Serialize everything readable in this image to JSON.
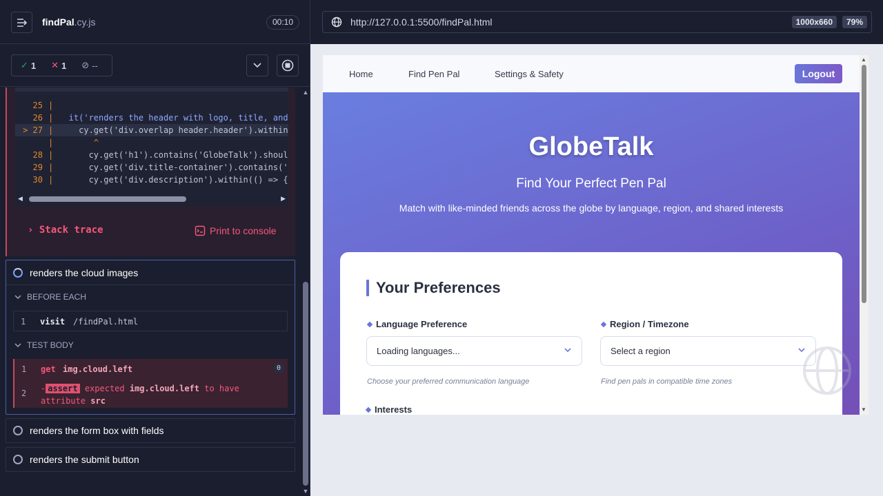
{
  "spec": {
    "name": "findPal",
    "ext": ".cy.js",
    "timer": "00:10"
  },
  "stats": {
    "passed": "1",
    "failed": "1",
    "pending": "--"
  },
  "code": {
    "lines": [
      {
        "num": "25",
        "text": ""
      },
      {
        "num": "26",
        "text": "  it('renders the header with logo, title, and d"
      },
      {
        "num": "27",
        "text": "    cy.get('div.overlap header.header').within("
      },
      {
        "num": "",
        "text": "       ^"
      },
      {
        "num": "28",
        "text": "      cy.get('h1').contains('GlobeTalk').should"
      },
      {
        "num": "29",
        "text": "      cy.get('div.title-container').contains('Fi"
      },
      {
        "num": "30",
        "text": "      cy.get('div.description').within(() => {"
      }
    ],
    "active_marker": ">"
  },
  "error_actions": {
    "stack_trace": "Stack trace",
    "print_console": "Print to console"
  },
  "active_test": {
    "title": "renders the cloud images",
    "before_each": "BEFORE EACH",
    "test_body": "TEST BODY",
    "visit": {
      "num": "1",
      "name": "visit",
      "arg": "/findPal.html"
    },
    "get": {
      "num": "1",
      "name": "get",
      "arg": "img.cloud.left",
      "badge": "0"
    },
    "assert": {
      "num": "2",
      "prefix": "-",
      "tag": "assert",
      "w1": "expected",
      "w2": "img.cloud.left",
      "w3": "to have",
      "w4": "attribute",
      "w5": "src"
    }
  },
  "tests": [
    {
      "title": "renders the form box with fields"
    },
    {
      "title": "renders the submit button"
    }
  ],
  "browser": {
    "url": "http://127.0.0.1:5500/findPal.html",
    "viewport": "1000x660",
    "zoom": "79%"
  },
  "app": {
    "nav": [
      "Home",
      "Find Pen Pal",
      "Settings & Safety"
    ],
    "logout": "Logout",
    "title": "GlobeTalk",
    "subtitle": "Find Your Perfect Pen Pal",
    "description": "Match with like-minded friends across the globe by language, region, and shared interests",
    "card_title": "Your Preferences",
    "language_label": "Language Preference",
    "language_value": "Loading languages...",
    "language_hint": "Choose your preferred communication language",
    "region_label": "Region / Timezone",
    "region_value": "Select a region",
    "region_hint": "Find pen pals in compatible time zones",
    "interests_label": "Interests"
  },
  "colors": {
    "pass": "#1fa971",
    "fail": "#f4587b",
    "accent": "#6a75d8"
  }
}
